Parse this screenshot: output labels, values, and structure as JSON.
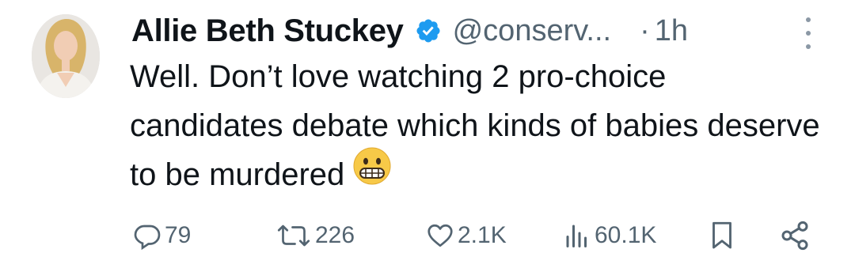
{
  "tweet": {
    "author_name": "Allie Beth Stuckey",
    "handle": "@conserv...",
    "separator": "·",
    "time": "1h",
    "text": "Well. Don’t love watching 2 pro-choice candidates debate which kinds of babies deserve to be murdered",
    "emoji": "grimacing-face",
    "verified_color": "#1d9bf0"
  },
  "actions": {
    "replies": "79",
    "retweets": "226",
    "likes": "2.1K",
    "views": "60.1K"
  },
  "colors": {
    "text": "#0f1419",
    "muted": "#536471",
    "icon": "#536471"
  }
}
